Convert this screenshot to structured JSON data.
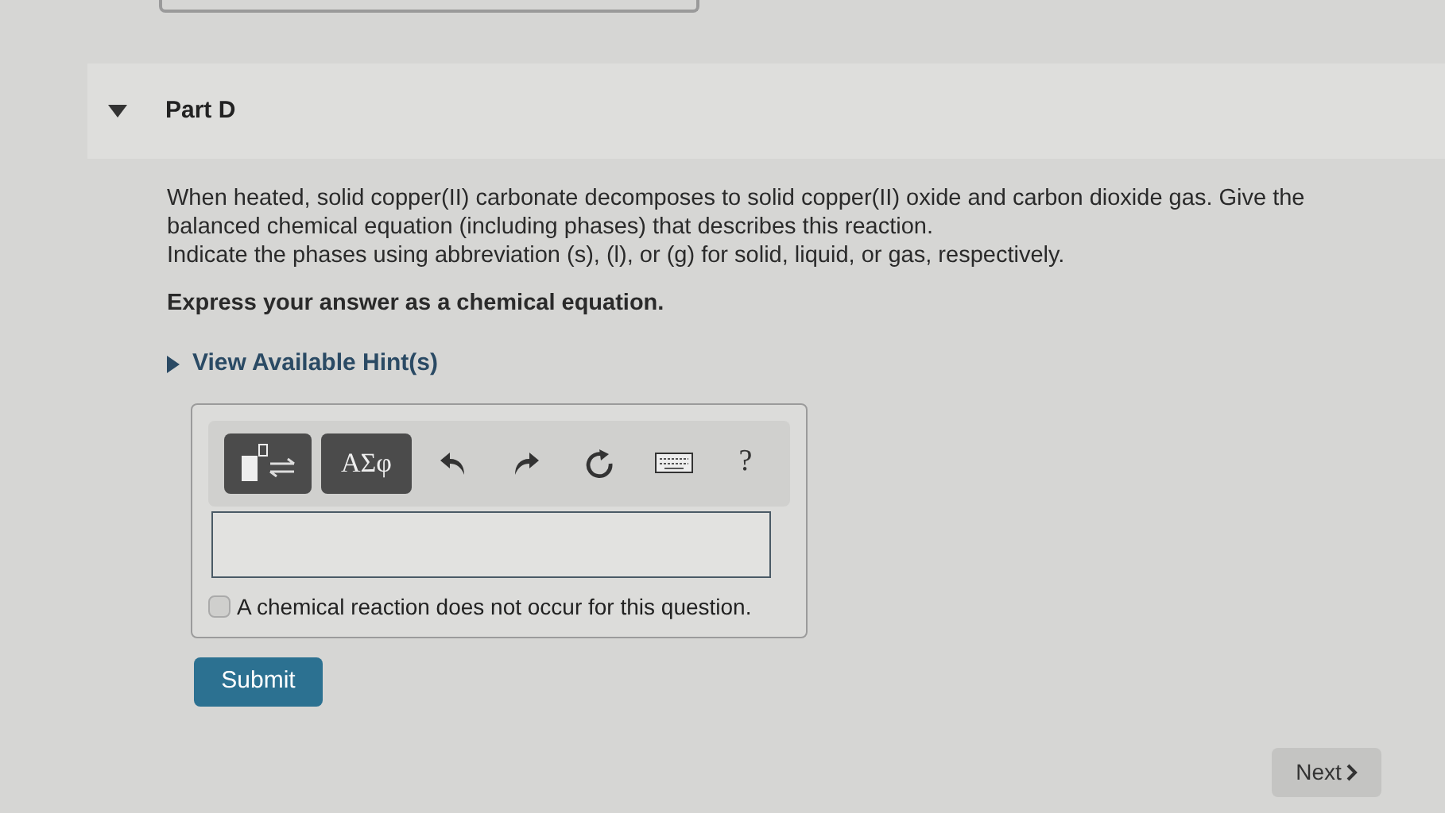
{
  "part": {
    "title": "Part D",
    "expanded": true
  },
  "question": [
    "When heated, solid copper(II) carbonate decomposes to solid copper(II) oxide and carbon dioxide gas. Give the balanced chemical equation (including phases) that describes this reaction.",
    "Indicate the phases using abbreviation (s), (l), or (g) for solid, liquid, or gas, respectively."
  ],
  "instruction": "Express your answer as a chemical equation.",
  "hint_link": {
    "label": "View Available Hint(s)",
    "expanded": false
  },
  "toolbar": [
    {
      "kind": "template"
    },
    {
      "kind": "symbols",
      "label": "ΑΣφ"
    },
    {
      "kind": "undo"
    },
    {
      "kind": "redo"
    },
    {
      "kind": "reset"
    },
    {
      "kind": "keyboard"
    },
    {
      "kind": "help",
      "label": "?"
    }
  ],
  "no_reaction_checkbox": {
    "label": "A chemical reaction does not occur for this question.",
    "checked": false
  },
  "submit_button": "Submit",
  "next_button": "Next"
}
